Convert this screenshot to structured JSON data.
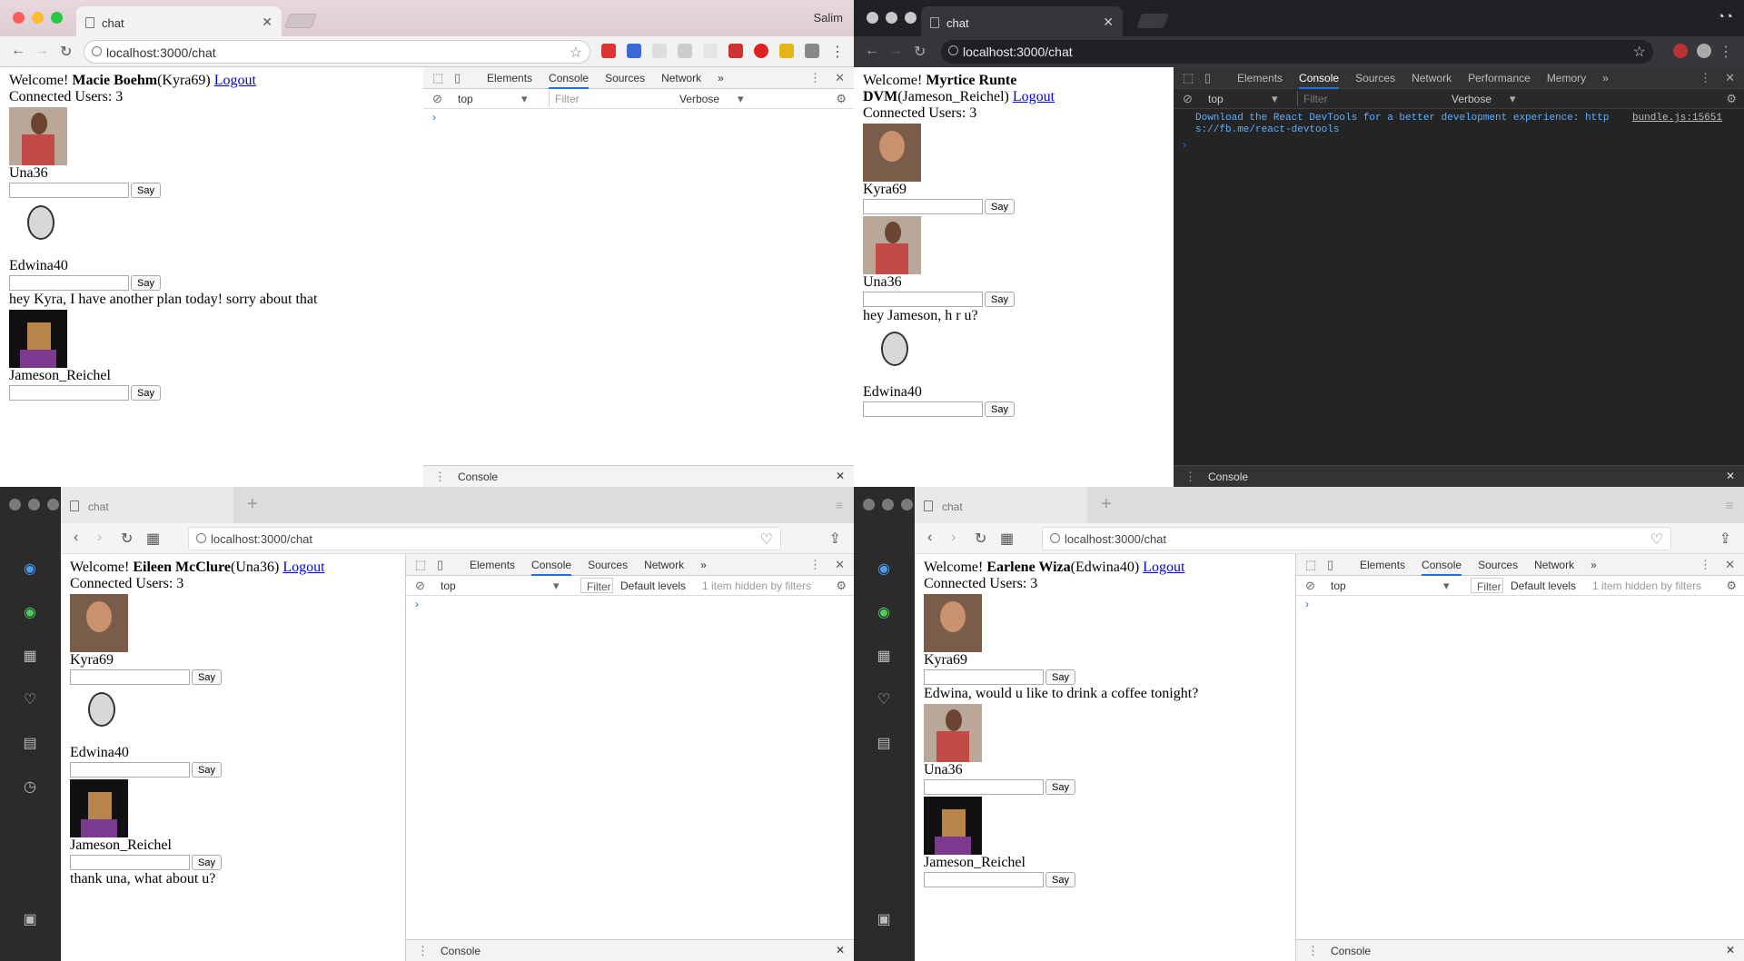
{
  "tab_title": "chat",
  "url": "localhost:3000/chat",
  "profile_name": "Salim",
  "say_label": "Say",
  "logout_label": "Logout",
  "welcome_label": "Welcome!",
  "connected_label": "Connected Users: 3",
  "devtools": {
    "tabs_short": [
      "Elements",
      "Console",
      "Sources",
      "Network"
    ],
    "tabs_long": [
      "Elements",
      "Console",
      "Sources",
      "Network",
      "Performance",
      "Memory"
    ],
    "more": "»",
    "context": "top",
    "filter_placeholder": "Filter",
    "filter_label": "Filter",
    "verbose": "Verbose",
    "default_levels": "Default levels",
    "hidden": "1 item hidden by filters",
    "drawer": "Console",
    "react_msg_1": "Download the React DevTools for a better development experience: http",
    "react_msg_2": "s://fb.me/react-devtools",
    "react_src": "bundle.js:15651"
  },
  "windows": [
    {
      "user_full": "Macie Boehm",
      "user_handle": "(Kyra69)",
      "contacts": [
        {
          "name": "Una36",
          "avatar": "una",
          "message": ""
        },
        {
          "name": "Edwina40",
          "avatar": "edw",
          "message": "hey Kyra, I have another plan today! sorry about that"
        },
        {
          "name": "Jameson_Reichel",
          "avatar": "jam",
          "message": ""
        }
      ]
    },
    {
      "user_full": "Myrtice Runte DVM",
      "user_handle": "(Jameson_Reichel)",
      "contacts": [
        {
          "name": "Kyra69",
          "avatar": "kyra",
          "message": ""
        },
        {
          "name": "Una36",
          "avatar": "una",
          "message": "hey Jameson, h r u?"
        },
        {
          "name": "Edwina40",
          "avatar": "edw",
          "message": ""
        }
      ]
    },
    {
      "user_full": "Eileen McClure",
      "user_handle": "(Una36)",
      "contacts": [
        {
          "name": "Kyra69",
          "avatar": "kyra",
          "message": ""
        },
        {
          "name": "Edwina40",
          "avatar": "edw",
          "message": ""
        },
        {
          "name": "Jameson_Reichel",
          "avatar": "jam",
          "message": "thank una, what about u?"
        }
      ]
    },
    {
      "user_full": "Earlene Wiza",
      "user_handle": "(Edwina40)",
      "contacts": [
        {
          "name": "Kyra69",
          "avatar": "kyra",
          "message": "Edwina, would u like to drink a coffee tonight?"
        },
        {
          "name": "Una36",
          "avatar": "una",
          "message": ""
        },
        {
          "name": "Jameson_Reichel",
          "avatar": "jam",
          "message": ""
        }
      ]
    }
  ]
}
